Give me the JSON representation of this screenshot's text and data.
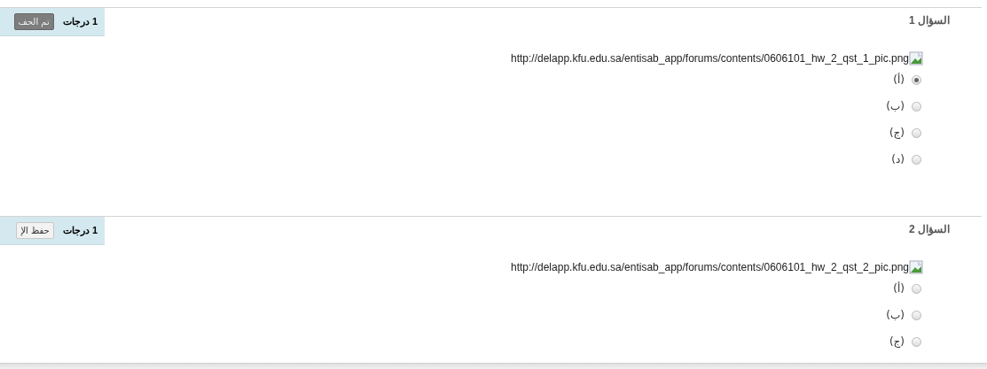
{
  "questions": [
    {
      "title": "السؤال 1",
      "grade": "1 درجات",
      "button": {
        "label": "تم الحف",
        "disabled": true
      },
      "image_url": "http://delapp.kfu.edu.sa/entisab_app/forums/contents/0606101_hw_2_qst_1_pic.png",
      "options": [
        {
          "label": "(أ)",
          "selected": true
        },
        {
          "label": "(ب)",
          "selected": false
        },
        {
          "label": "(ج)",
          "selected": false
        },
        {
          "label": "(د)",
          "selected": false
        }
      ]
    },
    {
      "title": "السؤال 2",
      "grade": "1 درجات",
      "button": {
        "label": "حفظ الإ",
        "disabled": false
      },
      "image_url": "http://delapp.kfu.edu.sa/entisab_app/forums/contents/0606101_hw_2_qst_2_pic.png",
      "options": [
        {
          "label": "(أ)",
          "selected": false
        },
        {
          "label": "(ب)",
          "selected": false
        },
        {
          "label": "(ج)",
          "selected": false
        }
      ]
    }
  ]
}
